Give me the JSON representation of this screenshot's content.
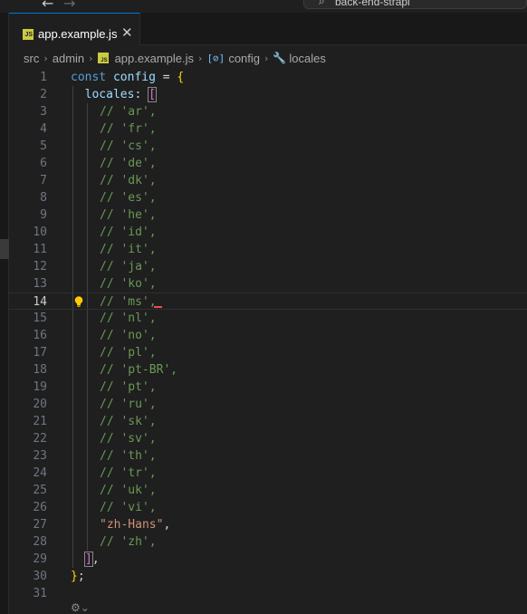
{
  "window": {
    "search_text": "back-end-strapi",
    "back_arrow": "←",
    "forward_arrow": "→",
    "search_icon": "search-icon"
  },
  "tab": {
    "icon_text": "JS",
    "label": "app.example.js",
    "close": "✕"
  },
  "breadcrumb": {
    "items": [
      "src",
      "admin",
      "app.example.js",
      "config",
      "locales"
    ],
    "separator": "›",
    "symbol_icon": "[⊘]",
    "wrench_icon": "🔧"
  },
  "editor": {
    "active_line": 14,
    "lines": [
      {
        "n": "1"
      },
      {
        "n": "2"
      },
      {
        "n": "3"
      },
      {
        "n": "4"
      },
      {
        "n": "5"
      },
      {
        "n": "6"
      },
      {
        "n": "7"
      },
      {
        "n": "8"
      },
      {
        "n": "9"
      },
      {
        "n": "10"
      },
      {
        "n": "11"
      },
      {
        "n": "12"
      },
      {
        "n": "13"
      },
      {
        "n": "14"
      },
      {
        "n": "15"
      },
      {
        "n": "16"
      },
      {
        "n": "17"
      },
      {
        "n": "18"
      },
      {
        "n": "19"
      },
      {
        "n": "20"
      },
      {
        "n": "21"
      },
      {
        "n": "22"
      },
      {
        "n": "23"
      },
      {
        "n": "24"
      },
      {
        "n": "25"
      },
      {
        "n": "26"
      },
      {
        "n": "27"
      },
      {
        "n": "28"
      },
      {
        "n": "29"
      },
      {
        "n": "30"
      },
      {
        "n": "31"
      }
    ],
    "code": {
      "l1": {
        "kw": "const",
        "name": "config",
        "eq": "=",
        "brace": "{"
      },
      "l2": {
        "key": "locales",
        "colon": ":",
        "bracket": "["
      },
      "comments": [
        "// 'ar',",
        "// 'fr',",
        "// 'cs',",
        "// 'de',",
        "// 'dk',",
        "// 'es',",
        "// 'he',",
        "// 'id',",
        "// 'it',",
        "// 'ja',",
        "// 'ko',",
        "// 'ms',",
        "// 'nl',",
        "// 'no',",
        "// 'pl',",
        "// 'pt-BR',",
        "// 'pt',",
        "// 'ru',",
        "// 'sk',",
        "// 'sv',",
        "// 'th',",
        "// 'tr',",
        "// 'uk',",
        "// 'vi',"
      ],
      "l27": {
        "string": "\"zh-Hans\"",
        "comma": ","
      },
      "l28": {
        "comment": "// 'zh',"
      },
      "l29": {
        "bracket": "]",
        "comma": ","
      },
      "l30": {
        "brace": "}",
        "semi": ";"
      }
    }
  },
  "footer": {
    "gear_icon": "⚙⌄"
  }
}
